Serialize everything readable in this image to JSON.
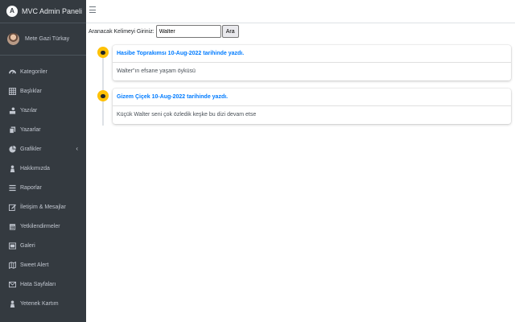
{
  "brand": {
    "title": "MVC Admin Paneli",
    "logo_letter": "A"
  },
  "user": {
    "name": "Mete Gazi Türkay"
  },
  "sidebar": {
    "items": [
      {
        "label": "Kategoriler",
        "icon": "dashboard-icon"
      },
      {
        "label": "Başlıklar",
        "icon": "table-icon"
      },
      {
        "label": "Yazılar",
        "icon": "writer-icon"
      },
      {
        "label": "Yazarlar",
        "icon": "copy-icon"
      },
      {
        "label": "Grafikler",
        "icon": "pie-chart-icon"
      },
      {
        "label": "Hakkımızda",
        "icon": "user-icon"
      },
      {
        "label": "Raporlar",
        "icon": "list-icon"
      },
      {
        "label": "İletişim & Mesajlar",
        "icon": "edit-icon"
      },
      {
        "label": "Yetkilendirmeler",
        "icon": "calendar-icon"
      },
      {
        "label": "Galeri",
        "icon": "image-icon"
      },
      {
        "label": "Sweet Alert",
        "icon": "map-icon"
      },
      {
        "label": "Hata Sayfaları",
        "icon": "envelope-icon"
      },
      {
        "label": "Yetenek Kartım",
        "icon": "user-icon"
      }
    ]
  },
  "search": {
    "label": "Aranacak Kelimeyi Giriniz:",
    "value": "Walter",
    "button": "Ara"
  },
  "timeline": [
    {
      "header": "Hasibe Toprakımsı 10-Aug-2022 tarihinde yazdı.",
      "body": "Walter\"ın efsane yaşam öyküsü"
    },
    {
      "header": "Gizem Çiçek 10-Aug-2022 tarihinde yazdı.",
      "body": "Küçük Walter seni çok özledik keşke bu dizi devam etse"
    }
  ],
  "colors": {
    "sidebar_bg": "#343a40",
    "accent": "#007bff",
    "timeline_dot": "#ffc107"
  }
}
